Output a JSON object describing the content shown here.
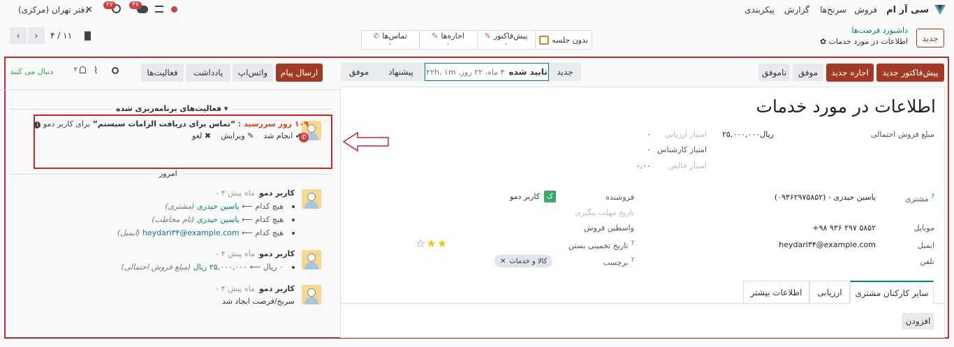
{
  "colors": {
    "brand": "#a33a24",
    "link": "#017e84",
    "highlight": "#d32f2f"
  },
  "topnav": {
    "app": "سی آر ام",
    "menu": [
      "فروش",
      "سرنخ‌ها",
      "گزارش",
      "پیکربندی"
    ],
    "company": "دفتر تهران (مرکزی)",
    "badge_activity": "۲۷",
    "badge_chat": "۴۷"
  },
  "control": {
    "new_button": "جدید",
    "breadcrumb_parent": "داشبورد فرصت‌ها",
    "breadcrumb_current": "اطلاعات در مورد خدمات",
    "pager": "۴ / ۱۱"
  },
  "smart_buttons": [
    {
      "label": "بدون جلسه",
      "count": ""
    },
    {
      "label": "پیش‌فاکتور",
      "count": "۰"
    },
    {
      "label": "اجاره‌ها",
      "count": "۰"
    },
    {
      "label": "تماس‌ها",
      "count": "۰"
    }
  ],
  "actions": {
    "new_quote": "پیش‌فاکتور جدید",
    "new_rental": "اجاره جدید",
    "won": "موفق",
    "lost": "ناموفق"
  },
  "stages": {
    "new": "جدید",
    "confirmed": "تایید شده",
    "confirmed_info": "۴ ماه، ۲۲ روز، ۲۲h، ۱m",
    "proposal": "پیشنهاد",
    "won": "موفق"
  },
  "form": {
    "title": "اطلاعات در مورد خدمات",
    "expected_revenue_label": "مبلغ فروش احتمالی",
    "expected_revenue": "۲۵,۰۰۰,۰۰۰ریال",
    "eval_score_label": "امتیاز ارزیابی",
    "eval_score": "۰",
    "expert_score_label": "امتیاز کارشناس",
    "expert_score": "۰",
    "net_score_label": "امتیاز خالص",
    "net_score": "۰.۰۰",
    "customer_label": "مشتری",
    "customer": "یاسین حیدری - (۰۹۳۶۲۹۷۵۸۵۲)",
    "mobile_label": "موبایل",
    "mobile": "+۹۸ ۹۳۶ ۲۹۷ ۵۸۵۲",
    "email_label": "ایمیل",
    "email": "heydari۳۴@example.com",
    "phone_label": "تلفن",
    "salesperson_label": "فروشنده",
    "salesperson": "کاربر دمو",
    "salesperson_initial": "ک",
    "followup_label": "تاریخ مهلت پیگیری",
    "broker_label": "واسطین فروش",
    "close_date_label": "تاریخ تخمینی بستن",
    "tags_label": "برچسب",
    "tag": "کالا و خدمات",
    "priority_stars": 2,
    "tabs": [
      "سایر کارکنان مشتری",
      "ارزیابی",
      "اطلاعات بیشتر"
    ],
    "add_button": "افزودن"
  },
  "chatter": {
    "send_message": "ارسال پیام",
    "whatsapp": "واتس‌اپ",
    "log_note": "یادداشت",
    "activities": "فعالیت‌ها",
    "follow": "دنبال می کنید",
    "followers_count": "۲",
    "planned_header": "فعالیت‌های برنامه‌ریزی شده",
    "activity": {
      "due": "۱۰۹ روز سررسید :",
      "summary": "“تماس برای دریافت الزامات سیستم”",
      "for_user": "برای کاربر دمو",
      "done": "انجام شد",
      "edit": "ویرایش",
      "cancel": "لغو"
    },
    "today_header": "امروز",
    "messages": [
      {
        "author": "کاربر دمو",
        "time": "- ۴ ماه پیش",
        "lines": [
          {
            "old": "هیچ کدام",
            "new": "یاسین حیدری",
            "field": "(مشتری)"
          },
          {
            "old": "هیچ کدام",
            "new": "یاسین حیدری",
            "field": "(نام مخاطب)"
          },
          {
            "old": "هیچ کدام",
            "new": "heydari۳۴@example.com",
            "field": "(ایمیل)"
          }
        ]
      },
      {
        "author": "کاربر دمو",
        "time": "- ۴ ماه پیش",
        "lines": [
          {
            "old": "۰ ریال",
            "new": "۲۵,۰۰۰,۰۰۰ ریال",
            "field": "(مبلغ فروش احتمالی)"
          }
        ]
      },
      {
        "author": "کاربر دمو",
        "time": "- ۴ ماه پیش",
        "text": "سرنخ/فرصت ایجاد شد"
      }
    ]
  }
}
